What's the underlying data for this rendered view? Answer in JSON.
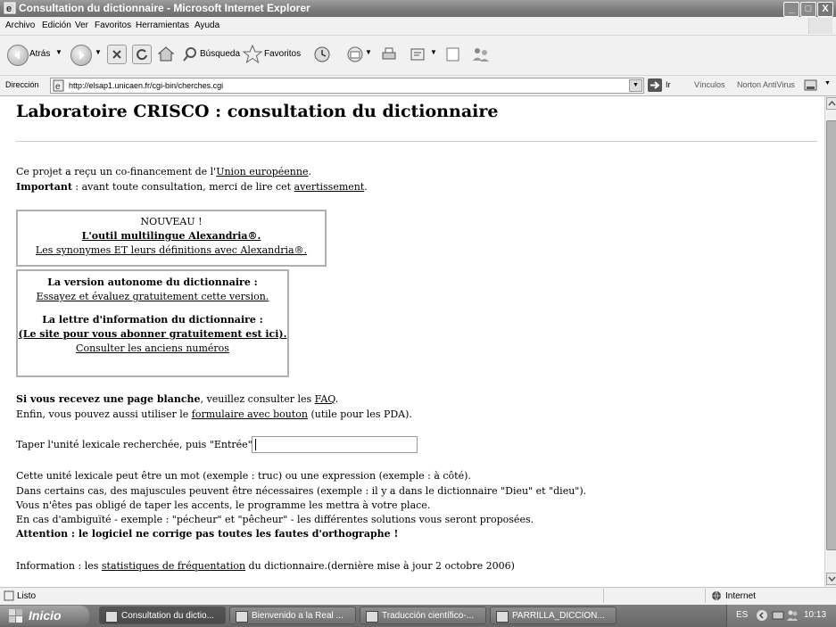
{
  "window": {
    "title": "Consultation du dictionnaire - Microsoft Internet Explorer",
    "minimize": "_",
    "maximize": "□",
    "close": "X"
  },
  "menu": [
    "Archivo",
    "Edición",
    "Ver",
    "Favoritos",
    "Herramientas",
    "Ayuda"
  ],
  "toolbar": {
    "back": "Atrás",
    "search": "Búsqueda",
    "favorites": "Favoritos"
  },
  "address": {
    "label": "Dirección",
    "url": "http://elsap1.unicaen.fr/cgi-bin/cherches.cgi",
    "go": "Ir",
    "links": "Vínculos",
    "norton": "Norton AntiVirus"
  },
  "page": {
    "title": "Laboratoire CRISCO : consultation du dictionnaire",
    "funding_prefix": "Ce projet a reçu un co-financement de l'",
    "funding_link": "Union européenne",
    "funding_suffix": ".",
    "important_label": "Important",
    "important_text": " : avant toute consultation, merci de lire cet ",
    "important_link": "avertissement",
    "important_suffix": ".",
    "box1": {
      "heading": "NOUVEAU !",
      "link1": "L'outil multilingue Alexandria®.",
      "link2": "Les synonymes ET leurs définitions avec Alexandria®."
    },
    "box2": {
      "heading1": "La version autonome du dictionnaire :",
      "link1": "Essayez et évaluez gratuitement cette version.",
      "heading2": "La lettre d'information du dictionnaire :",
      "link2": "(Le site pour vous abonner gratuitement est ici).",
      "link3": "Consulter les anciens numéros"
    },
    "blank_bold": "Si vous recevez une page blanche",
    "blank_text": ", veuillez consulter les ",
    "blank_link": "FAQ",
    "blank_suffix": ".",
    "form_prefix": "Enfin, vous pouvez aussi utiliser le ",
    "form_link": "formulaire avec bouton",
    "form_suffix": " (utile pour les PDA).",
    "input_label": "Taper l'unité lexicale recherchée, puis \"Entrée\" :",
    "input_value": "",
    "info_lines": [
      "Cette unité lexicale peut être un mot (exemple : truc) ou une expression (exemple : à côté).",
      "Dans certains cas, des majuscules peuvent être nécessaires (exemple : il y a dans le dictionnaire \"Dieu\" et \"dieu\").",
      "Vous n'êtes pas obligé de taper les accents, le programme les mettra à votre place.",
      "En cas d'ambiguïté - exemple : \"pécheur\" et \"pêcheur\" - les différentes solutions vous seront proposées."
    ],
    "attention": "Attention : le logiciel ne corrige pas toutes les fautes d'orthographe !",
    "stats_prefix": "Information : les ",
    "stats_link": "statistiques de fréquentation",
    "stats_suffix": " du dictionnaire.(dernière mise à jour 2 octobre 2006)"
  },
  "status": {
    "text": "Listo",
    "zone": "Internet"
  },
  "taskbar": {
    "start": "Inicio",
    "tasks": [
      "Consultation du dictio...",
      "Bienvenido a la Real ...",
      "Traducción científico-...",
      "PARRILLA_DICCION..."
    ],
    "lang": "ES",
    "clock": "10:13"
  }
}
